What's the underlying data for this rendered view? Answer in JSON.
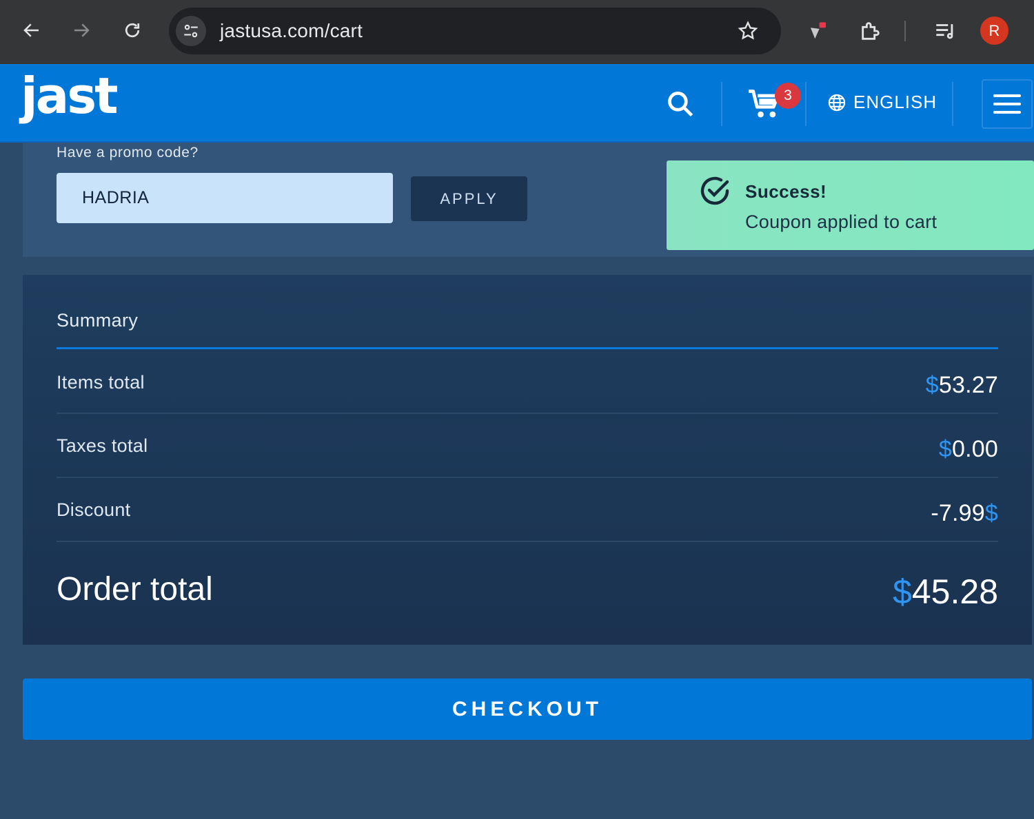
{
  "browser": {
    "url": "jastusa.com/cart",
    "profile_initial": "R"
  },
  "header": {
    "logo": "jast",
    "cart_count": "3",
    "language": "ENGLISH"
  },
  "promo": {
    "label": "Have a promo code?",
    "value": "HADRIA",
    "apply_label": "APPLY"
  },
  "toast": {
    "title": "Success!",
    "message": "Coupon applied to cart"
  },
  "summary": {
    "title": "Summary",
    "currency_symbol": "$",
    "rows": [
      {
        "label": "Items total",
        "amount": "53.27"
      },
      {
        "label": "Taxes total",
        "amount": "0.00"
      },
      {
        "label": "Discount",
        "amount": "-7.99"
      }
    ],
    "total_label": "Order total",
    "total_amount": "45.28"
  },
  "checkout_label": "CHECKOUT",
  "colors": {
    "brand_blue": "#0177d7",
    "success_green": "#8ae4c3",
    "accent_currency": "#2f95f0"
  }
}
